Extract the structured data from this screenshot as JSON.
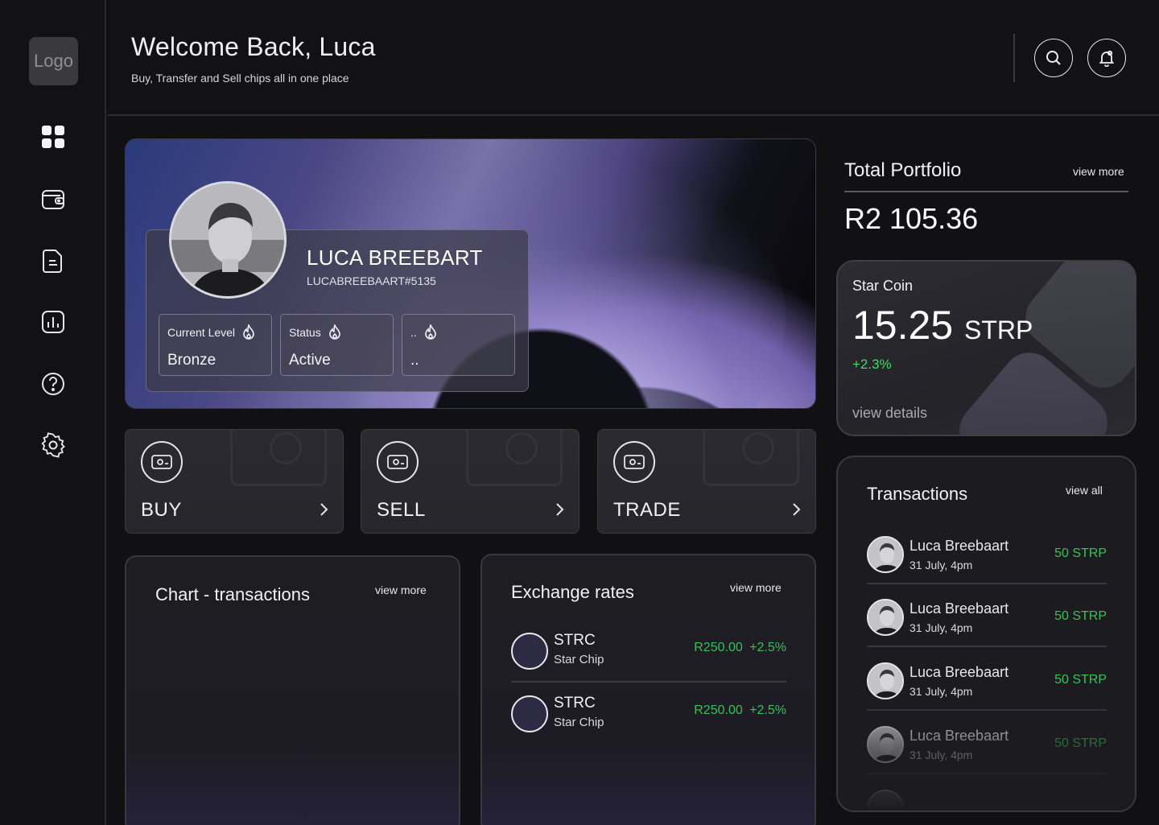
{
  "logo": {
    "label": "Logo"
  },
  "header": {
    "title": "Welcome Back, Luca",
    "subtitle": "Buy, Transfer and Sell chips all in one place"
  },
  "sidebar": {
    "items": [
      {
        "icon": "dashboard-icon",
        "active": true
      },
      {
        "icon": "wallet-icon"
      },
      {
        "icon": "document-icon"
      },
      {
        "icon": "bar-chart-icon"
      },
      {
        "icon": "help-icon"
      },
      {
        "icon": "settings-icon"
      }
    ]
  },
  "profile": {
    "name": "LUCA BREEBART",
    "tag": "LUCABREEBAART#5135",
    "stats": [
      {
        "label": "Current Level",
        "value": "Bronze"
      },
      {
        "label": "Status",
        "value": "Active"
      },
      {
        "label": "..",
        "value": ".."
      }
    ]
  },
  "actions": [
    {
      "label": "BUY"
    },
    {
      "label": "SELL"
    },
    {
      "label": "TRADE"
    }
  ],
  "portfolio": {
    "title": "Total Portfolio",
    "view_more": "view more",
    "value": "R2 105.36"
  },
  "coin": {
    "name": "Star Coin",
    "amount": "15.25",
    "unit": "STRP",
    "change": "+2.3%",
    "details": "view details"
  },
  "chart_panel": {
    "title": "Chart - transactions",
    "view_more": "view more"
  },
  "exchange": {
    "title": "Exchange rates",
    "view_more": "view more",
    "rows": [
      {
        "symbol": "STRC",
        "name": "Star Chip",
        "value": "R250.00 +2.5%"
      },
      {
        "symbol": "STRC",
        "name": "Star Chip",
        "value": "R250.00 +2.5%"
      }
    ]
  },
  "transactions": {
    "title": "Transactions",
    "view_all": "view all",
    "rows": [
      {
        "name": "Luca Breebaart",
        "date": "31 July, 4pm",
        "amount": "50 STRP"
      },
      {
        "name": "Luca Breebaart",
        "date": "31 July, 4pm",
        "amount": "50 STRP"
      },
      {
        "name": "Luca Breebaart",
        "date": "31 July, 4pm",
        "amount": "50 STRP"
      },
      {
        "name": "Luca Breebaart",
        "date": "31 July, 4pm",
        "amount": "50 STRP"
      }
    ]
  },
  "colors": {
    "positive": "#3bbf58",
    "accent_green": "#3fdc6a",
    "background": "#111113"
  }
}
